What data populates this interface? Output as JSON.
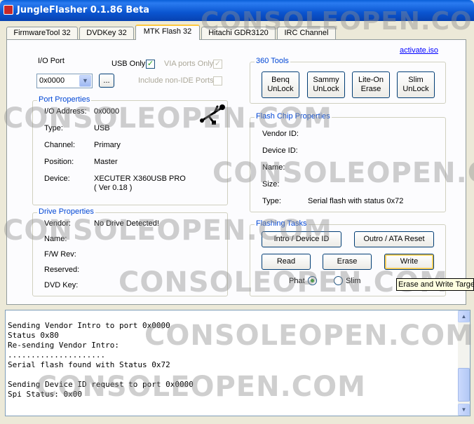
{
  "window": {
    "title": "JungleFlasher 0.1.86 Beta"
  },
  "tabs": [
    {
      "label": "FirmwareTool 32"
    },
    {
      "label": "DVDKey 32"
    },
    {
      "label": "MTK Flash 32",
      "active": true
    },
    {
      "label": "Hitachi GDR3120"
    },
    {
      "label": "IRC Channel"
    }
  ],
  "io": {
    "label": "I/O Port",
    "port_value": "0x0000",
    "browse_label": "...",
    "usb_only": {
      "label": "USB Only",
      "checked": true
    },
    "via_ports": {
      "label": "VIA ports Only",
      "checked": true,
      "disabled": true
    },
    "non_ide": {
      "label": "Include non-IDE Ports",
      "checked": false,
      "disabled": true
    }
  },
  "activate_link": "activate.iso",
  "port_properties": {
    "title": "Port Properties",
    "rows": [
      {
        "label": "I/O Address:",
        "value": "0x0000"
      },
      {
        "label": "Type:",
        "value": "USB"
      },
      {
        "label": "Channel:",
        "value": "Primary"
      },
      {
        "label": "Position:",
        "value": "Master"
      },
      {
        "label": "Device:",
        "value": "XECUTER X360USB PRO",
        "value2": "( Ver 0.18 )"
      }
    ]
  },
  "tools_360": {
    "title": "360 Tools",
    "buttons": [
      {
        "line1": "Benq",
        "line2": "UnLock"
      },
      {
        "line1": "Sammy",
        "line2": "UnLock"
      },
      {
        "line1": "Lite-On",
        "line2": "Erase"
      },
      {
        "line1": "Slim",
        "line2": "UnLock"
      }
    ]
  },
  "flash_chip": {
    "title": "Flash Chip Properties",
    "rows": [
      {
        "label": "Vendor ID:",
        "value": ""
      },
      {
        "label": "Device ID:",
        "value": ""
      },
      {
        "label": "Name:",
        "value": ""
      },
      {
        "label": "Size:",
        "value": ""
      },
      {
        "label": "Type:",
        "value": "Serial flash with status 0x72"
      }
    ]
  },
  "drive_properties": {
    "title": "Drive Properties",
    "rows": [
      {
        "label": "Vendor:",
        "value": "No Drive Detected!"
      },
      {
        "label": "Name:",
        "value": ""
      },
      {
        "label": "F/W Rev:",
        "value": ""
      },
      {
        "label": "Reserved:",
        "value": ""
      },
      {
        "label": "DVD Key:",
        "value": ""
      }
    ]
  },
  "flashing_tasks": {
    "title": "Flashing Tasks",
    "intro": "Intro / Device ID",
    "outro": "Outro / ATA Reset",
    "read": "Read",
    "erase": "Erase",
    "write": "Write",
    "phat": {
      "label": "Phat",
      "selected": true
    },
    "slim": {
      "label": "Slim",
      "selected": false
    }
  },
  "tooltip": "Erase and Write Target",
  "log_text": "Sending Vendor Intro to port 0x0000\nStatus 0x80\nRe-sending Vendor Intro:\n.....................\nSerial flash found with Status 0x72\n\nSending Device ID request to port 0x0000\nSpi Status: 0x00",
  "watermark": "CONSOLEOPEN.COM",
  "icons": {
    "usb": "usb-icon",
    "scroll_up": "arrow-up-icon",
    "scroll_down": "arrow-down-icon",
    "combo": "chevron-down-icon"
  },
  "colors": {
    "titlebar": "#0a55d0",
    "group_label": "#0046d5",
    "link": "#0000ff",
    "check": "#21a121"
  }
}
